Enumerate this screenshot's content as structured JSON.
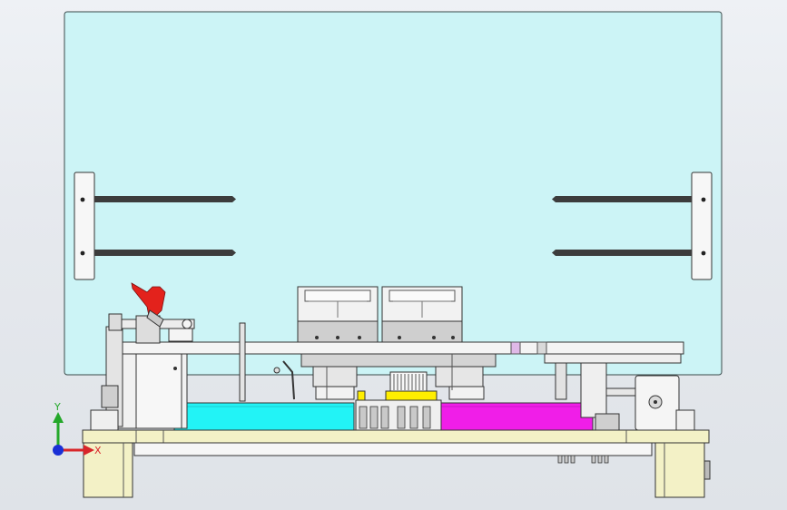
{
  "viewport": {
    "background": "#e6e9ee"
  },
  "colors": {
    "panel": "#ccf4f6",
    "panel_border": "#3a4a4a",
    "cyan_block": "#22f3f6",
    "magenta_block": "#f01ee8",
    "base_plate": "#f3f1c6",
    "red_handle": "#e3221c",
    "yellow_part": "#ffee00",
    "steel": "#c8c8c8",
    "frame": "#e9e9e9",
    "rail": "#3c3c3c",
    "axis_y": "#24a82a",
    "axis_x": "#d8262a",
    "axis_z": "#1a2fd6"
  },
  "triad": {
    "y_label": "Y",
    "x_label": "X"
  },
  "icons": {
    "triad": "coordinate-triad-icon",
    "clamp": "toggle-clamp-icon"
  }
}
